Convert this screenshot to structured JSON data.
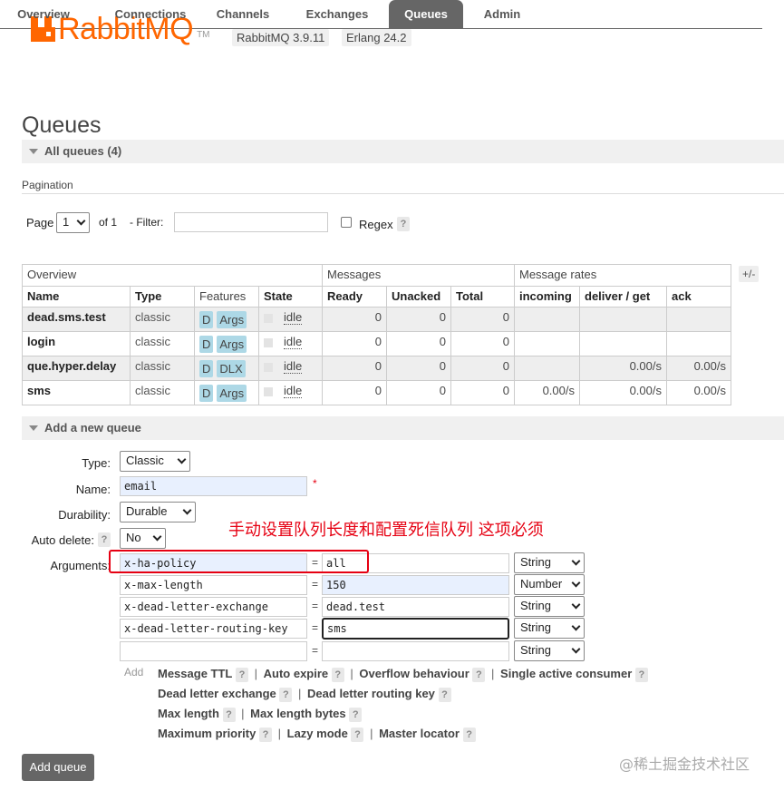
{
  "header": {
    "logo_text": "RabbitMQ",
    "logo_tm": "TM",
    "rabbitmq_version": "RabbitMQ 3.9.11",
    "erlang_version": "Erlang 24.2",
    "brand_color": "#ff6600"
  },
  "tabs": [
    {
      "label": "Overview"
    },
    {
      "label": "Connections"
    },
    {
      "label": "Channels"
    },
    {
      "label": "Exchanges"
    },
    {
      "label": "Queues"
    },
    {
      "label": "Admin"
    }
  ],
  "active_tab": "Queues",
  "page_title": "Queues",
  "all_queues_section": "All queues (4)",
  "pagination": {
    "label": "Pagination",
    "page_label": "Page",
    "page_value": "1",
    "of_label": "of 1",
    "filter_label": "- Filter:",
    "filter_value": "",
    "regex_label": "Regex",
    "help": "?"
  },
  "table": {
    "plus_minus": "+/-",
    "groups": {
      "overview": "Overview",
      "messages": "Messages",
      "rates": "Message rates"
    },
    "columns": {
      "name": "Name",
      "type": "Type",
      "features": "Features",
      "state": "State",
      "ready": "Ready",
      "unacked": "Unacked",
      "total": "Total",
      "incoming": "incoming",
      "deliver_get": "deliver / get",
      "ack": "ack"
    },
    "rows": [
      {
        "name": "dead.sms.test",
        "type": "classic",
        "feat1": "D",
        "feat2": "Args",
        "state": "idle",
        "ready": "0",
        "unacked": "0",
        "total": "0",
        "incoming": "",
        "deliver_get": "",
        "ack": ""
      },
      {
        "name": "login",
        "type": "classic",
        "feat1": "D",
        "feat2": "Args",
        "state": "idle",
        "ready": "0",
        "unacked": "0",
        "total": "0",
        "incoming": "",
        "deliver_get": "",
        "ack": ""
      },
      {
        "name": "que.hyper.delay",
        "type": "classic",
        "feat1": "D",
        "feat2": "DLX",
        "state": "idle",
        "ready": "0",
        "unacked": "0",
        "total": "0",
        "incoming": "",
        "deliver_get": "0.00/s",
        "ack": "0.00/s"
      },
      {
        "name": "sms",
        "type": "classic",
        "feat1": "D",
        "feat2": "Args",
        "state": "idle",
        "ready": "0",
        "unacked": "0",
        "total": "0",
        "incoming": "0.00/s",
        "deliver_get": "0.00/s",
        "ack": "0.00/s"
      }
    ]
  },
  "add_queue": {
    "section_title": "Add a new queue",
    "type_label": "Type:",
    "type_value": "Classic",
    "name_label": "Name:",
    "name_value": "email",
    "required_mark": "*",
    "durability_label": "Durability:",
    "durability_value": "Durable",
    "auto_delete_label": "Auto delete:",
    "auto_delete_help": "?",
    "auto_delete_value": "No",
    "arguments_label": "Arguments:",
    "arguments": [
      {
        "key": "x-ha-policy",
        "value": "all",
        "type": "String"
      },
      {
        "key": "x-max-length",
        "value": "150",
        "type": "Number"
      },
      {
        "key": "x-dead-letter-exchange",
        "value": "dead.test",
        "type": "String"
      },
      {
        "key": "x-dead-letter-routing-key",
        "value": "sms",
        "type": "String"
      },
      {
        "key": "",
        "value": "",
        "type": "String"
      }
    ],
    "equals": "=",
    "add_label": "Add",
    "shortcuts": {
      "message_ttl": "Message TTL",
      "auto_expire": "Auto expire",
      "overflow_behaviour": "Overflow behaviour",
      "single_active_consumer": "Single active consumer",
      "dead_letter_exchange": "Dead letter exchange",
      "dead_letter_routing_key": "Dead letter routing key",
      "max_length": "Max length",
      "max_length_bytes": "Max length bytes",
      "maximum_priority": "Maximum priority",
      "lazy_mode": "Lazy mode",
      "master_locator": "Master locator"
    },
    "separator": "|",
    "help": "?",
    "button_label": "Add queue"
  },
  "annotation": {
    "text": "手动设置队列长度和配置死信队列 这项必须",
    "color": "#e60012"
  },
  "watermark": "@稀土掘金技术社区"
}
